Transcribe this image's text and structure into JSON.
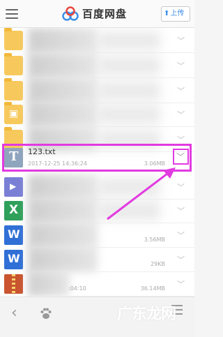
{
  "header": {
    "app_title": "百度网盘",
    "upload_label": "上传",
    "upload_icon": "upload-arrow-icon",
    "menu_icon": "hamburger-menu-icon",
    "logo_icon": "baidu-cloud-logo"
  },
  "files": [
    {
      "type": "folder",
      "name": "",
      "meta": "",
      "size": ""
    },
    {
      "type": "folder",
      "name": "",
      "meta": "",
      "size": ""
    },
    {
      "type": "folder",
      "name": "",
      "meta": "",
      "size": ""
    },
    {
      "type": "folder-photo",
      "name": "",
      "meta": "",
      "size": ""
    },
    {
      "type": "folder",
      "name": "",
      "meta": "",
      "size": ""
    },
    {
      "type": "txt",
      "name": "123.txt",
      "meta": "2017-12-25 14:36:24",
      "size": "3.06MB",
      "highlighted": true
    },
    {
      "type": "video",
      "name": "",
      "meta": "",
      "size": ""
    },
    {
      "type": "excel",
      "name": "",
      "meta": "",
      "size": ""
    },
    {
      "type": "word",
      "name": "",
      "meta": "",
      "size": "3.56MB"
    },
    {
      "type": "word",
      "name": "",
      "meta": "",
      "size": "29KB"
    },
    {
      "type": "zip",
      "name": "",
      "meta": ":04:10",
      "size": "36.14MB"
    }
  ],
  "colors": {
    "highlight": "#e23ae0",
    "folder": "#f7c95c",
    "accent": "#3b8ee8"
  },
  "bottom_nav": {
    "back_icon": "back-chevron-icon",
    "paw_icon": "baidu-paw-icon",
    "menu_icon": "list-menu-icon"
  },
  "watermark": "广东龙网"
}
